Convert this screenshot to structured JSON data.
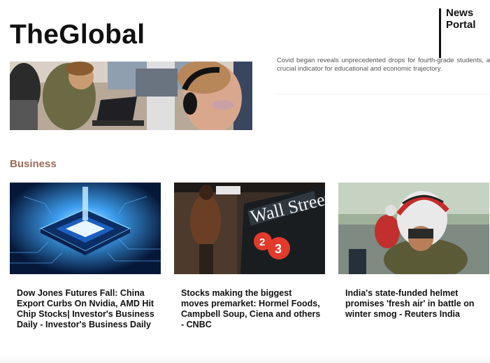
{
  "header": {
    "logo": "TheGlobal",
    "portal_line1": "News",
    "portal_line2": "Portal"
  },
  "top_story": {
    "summary_partial": "Covid began reveals unprecedented drops for fourth-grade students, a crucial indicator for educational and economic trajectory."
  },
  "business": {
    "section_title": "Business",
    "articles": [
      {
        "headline": "Dow Jones Futures Fall: China Export Curbs On Nvidia, AMD Hit Chip Stocks| Investor's Business Daily - Investor's Business Daily"
      },
      {
        "headline": "Stocks making the biggest moves premarket: Hormel Foods, Campbell Soup, Ciena and others - CNBC"
      },
      {
        "headline": "India's state-funded helmet promises 'fresh air' in battle on winter smog - Reuters India"
      }
    ],
    "image_text": {
      "wall_street": "Wall Street",
      "train_2": "2",
      "train_3": "3"
    }
  },
  "colors": {
    "section_title": "#9b6b58",
    "text": "#111111"
  }
}
